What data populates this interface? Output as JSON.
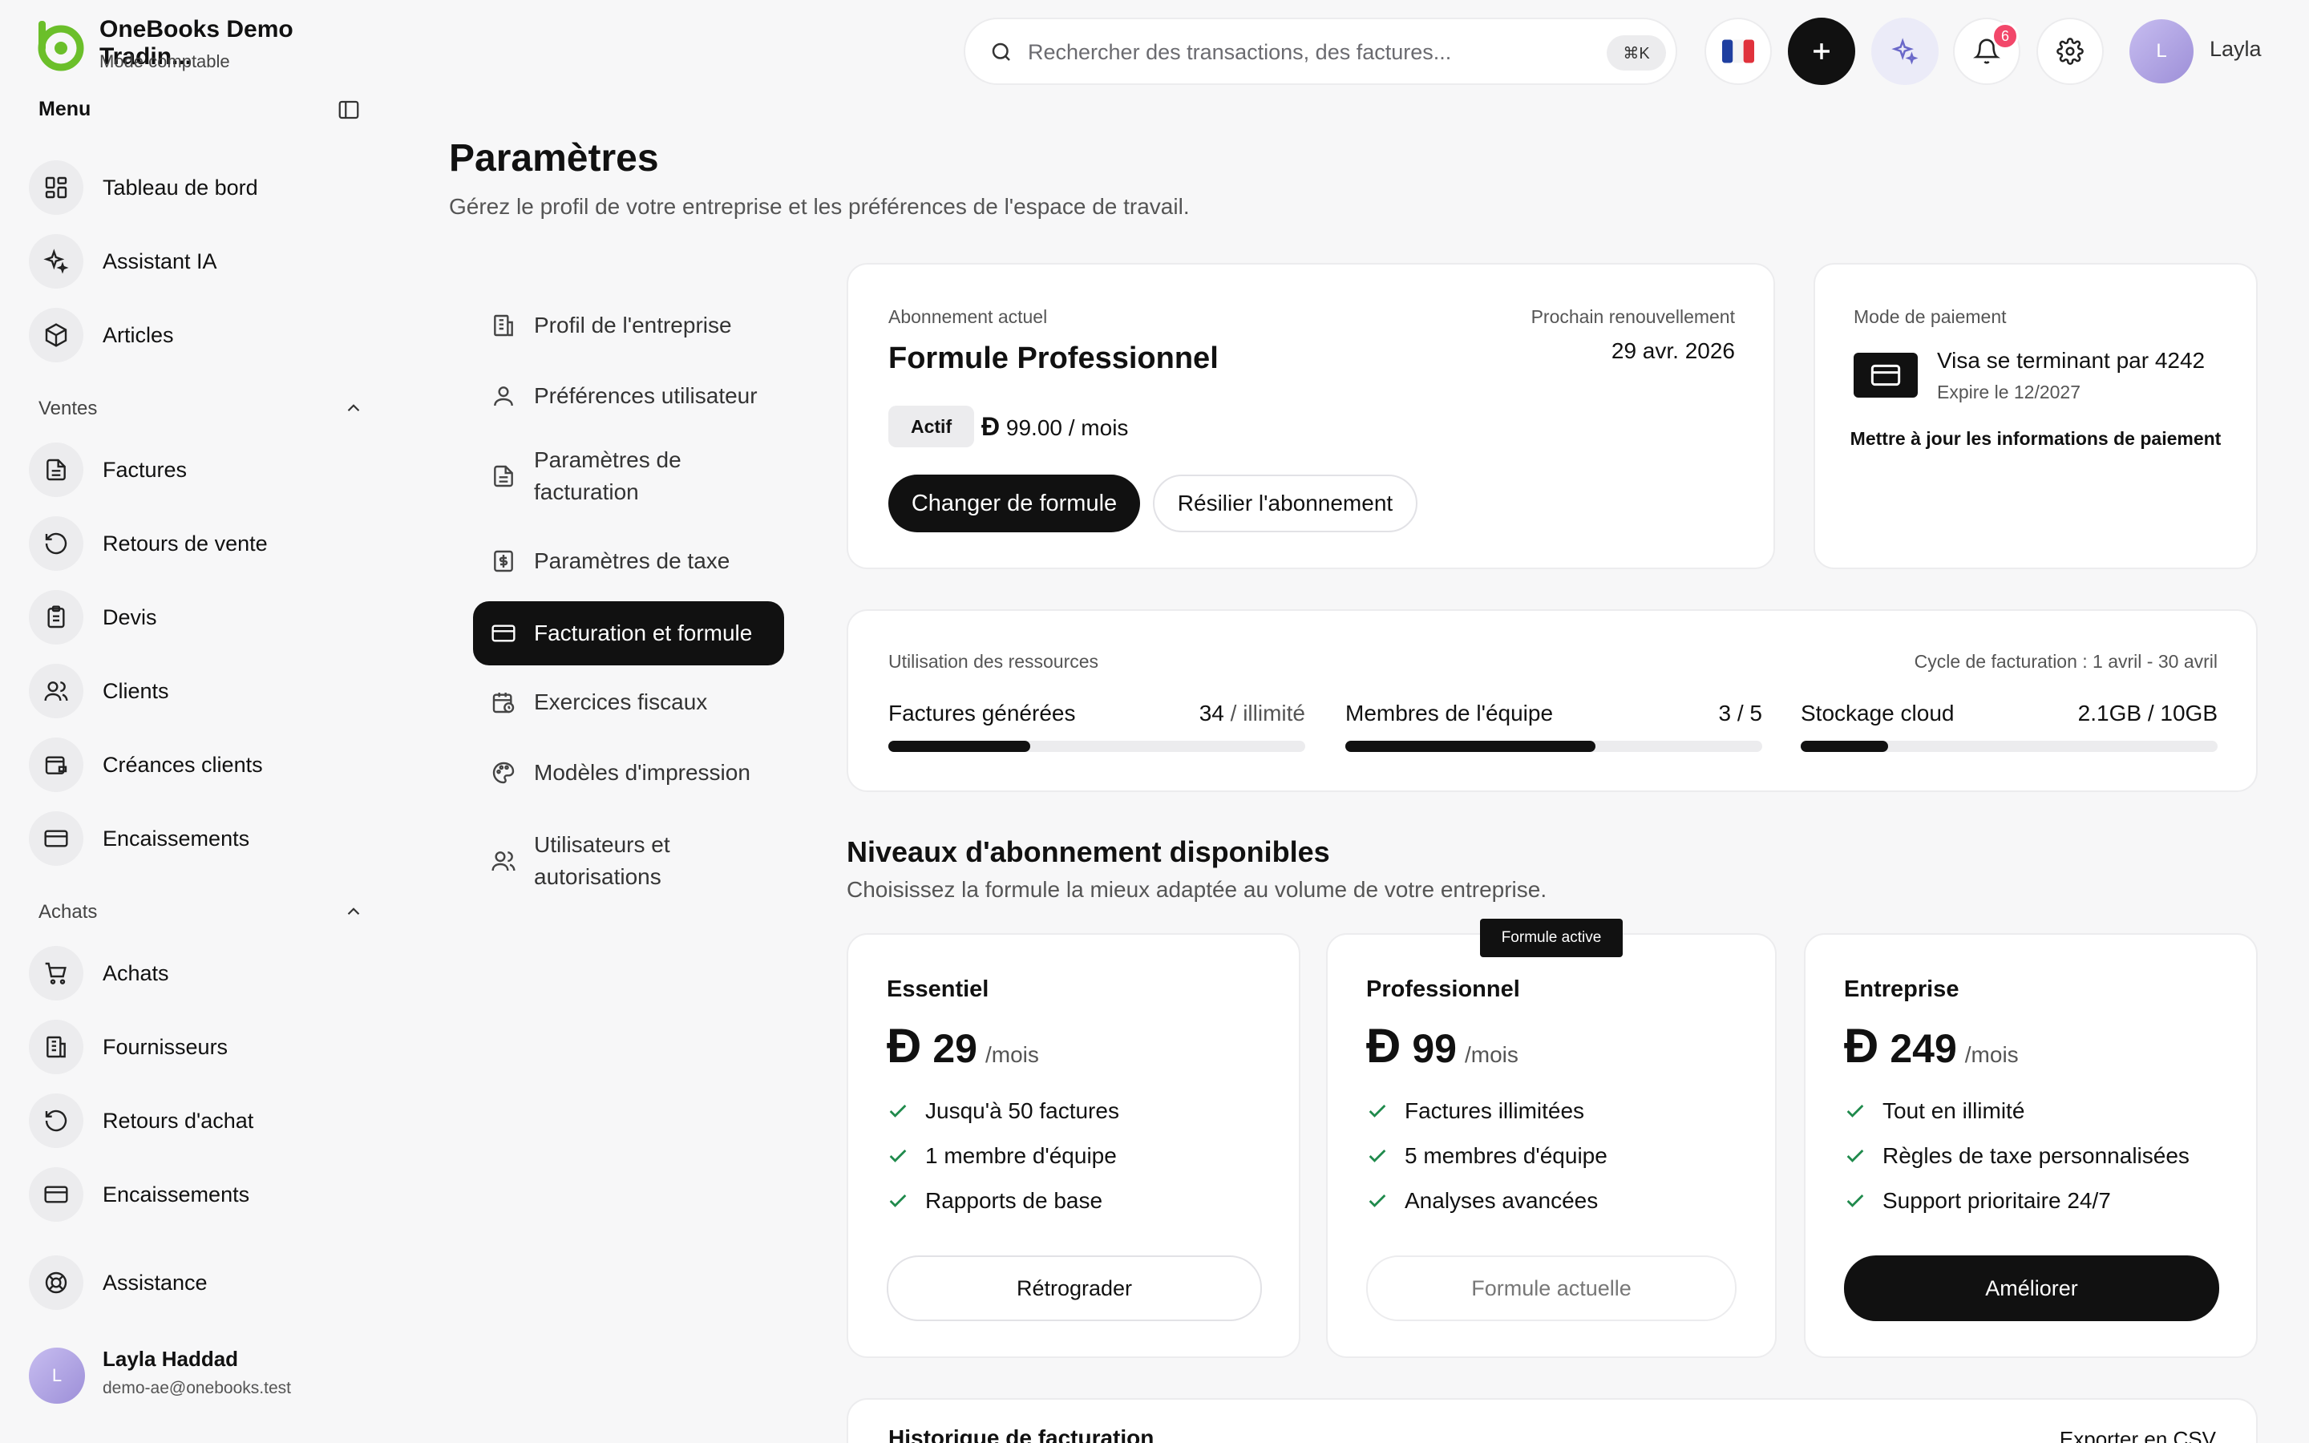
{
  "brand": {
    "name": "OneBooks Demo Tradin...",
    "mode": "Mode comptable"
  },
  "sidebar": {
    "menu_title": "Menu",
    "main_items": [
      {
        "label": "Tableau de bord",
        "icon": "dashboard-icon"
      },
      {
        "label": "Assistant IA",
        "icon": "sparkles-icon"
      },
      {
        "label": "Articles",
        "icon": "package-icon"
      }
    ],
    "sales": {
      "label": "Ventes",
      "items": [
        {
          "label": "Factures",
          "icon": "file-text-icon"
        },
        {
          "label": "Retours de vente",
          "icon": "rotate-ccw-icon"
        },
        {
          "label": "Devis",
          "icon": "clipboard-icon"
        },
        {
          "label": "Clients",
          "icon": "users-icon"
        },
        {
          "label": "Créances clients",
          "icon": "wallet-icon"
        },
        {
          "label": "Encaissements",
          "icon": "credit-card-icon"
        }
      ]
    },
    "purchases": {
      "label": "Achats",
      "items": [
        {
          "label": "Achats",
          "icon": "cart-icon"
        },
        {
          "label": "Fournisseurs",
          "icon": "building-icon"
        },
        {
          "label": "Retours d'achat",
          "icon": "rotate-ccw-icon"
        },
        {
          "label": "Encaissements",
          "icon": "credit-card-icon"
        }
      ]
    },
    "support_label": "Assistance",
    "user": {
      "initial": "L",
      "name": "Layla Haddad",
      "email": "demo-ae@onebooks.test"
    }
  },
  "topbar": {
    "search_placeholder": "Rechercher des transactions, des factures...",
    "search_shortcut": "⌘K",
    "notifications_count": "6",
    "user_initial": "L",
    "user_name": "Layla"
  },
  "page": {
    "title": "Paramètres",
    "subtitle": "Gérez le profil de votre entreprise et les préférences de l'espace de travail."
  },
  "settings_nav": [
    {
      "label": "Profil de l'entreprise",
      "icon": "building-icon"
    },
    {
      "label": "Préférences utilisateur",
      "icon": "user-icon"
    },
    {
      "label": "Paramètres de facturation",
      "icon": "file-text-icon"
    },
    {
      "label": "Paramètres de taxe",
      "icon": "receipt-icon"
    },
    {
      "label": "Facturation et formule",
      "icon": "credit-card-icon",
      "active": true
    },
    {
      "label": "Exercices fiscaux",
      "icon": "calendar-icon"
    },
    {
      "label": "Modèles d'impression",
      "icon": "palette-icon"
    },
    {
      "label": "Utilisateurs et autorisations",
      "icon": "users-icon"
    }
  ],
  "subscription": {
    "label": "Abonnement actuel",
    "plan": "Formule Professionnel",
    "renewal_label": "Prochain renouvellement",
    "renewal_date": "29 avr. 2026",
    "status": "Actif",
    "currency_symbol": "Đ",
    "price": "99.00 / mois",
    "change_button": "Changer de formule",
    "cancel_button": "Résilier l'abonnement"
  },
  "payment": {
    "label": "Mode de paiement",
    "card_text": "Visa se terminant par 4242",
    "expiry": "Expire le 12/2027",
    "update_link": "Mettre à jour les informations de paiement"
  },
  "usage": {
    "label": "Utilisation des ressources",
    "cycle": "Cycle de facturation : 1 avril - 30 avril",
    "items": [
      {
        "name": "Factures générées",
        "used": "34",
        "limit": " / illimité",
        "fill": 0.34
      },
      {
        "name": "Membres de l'équipe",
        "used": "3 / 5",
        "limit": "",
        "fill": 0.6
      },
      {
        "name": "Stockage cloud",
        "used": "2.1GB / 10GB",
        "limit": "",
        "fill": 0.21
      }
    ]
  },
  "tiers": {
    "title": "Niveaux d'abonnement disponibles",
    "subtitle": "Choisissez la formule la mieux adaptée au volume de votre entreprise.",
    "active_tag": "Formule active",
    "currency_symbol": "Đ",
    "period": "/mois",
    "plans": [
      {
        "name": "Essentiel",
        "price": "29",
        "features": [
          "Jusqu'à 50 factures",
          "1 membre d'équipe",
          "Rapports de base"
        ],
        "button": "Rétrograder"
      },
      {
        "name": "Professionnel",
        "price": "99",
        "features": [
          "Factures illimitées",
          "5 membres d'équipe",
          "Analyses avancées"
        ],
        "button": "Formule actuelle"
      },
      {
        "name": "Entreprise",
        "price": "249",
        "features": [
          "Tout en illimité",
          "Règles de taxe personnalisées",
          "Support prioritaire 24/7"
        ],
        "button": "Améliorer"
      }
    ]
  },
  "history": {
    "title": "Historique de facturation",
    "export": "Exporter en CSV"
  },
  "colors": {
    "brand_green": "#6bbf2a",
    "dark": "#111111",
    "badge_red": "#f2476a"
  }
}
